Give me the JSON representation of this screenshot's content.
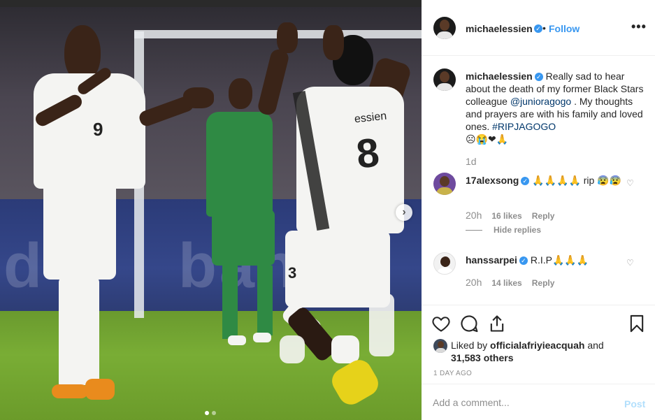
{
  "post": {
    "author": "michaelessien",
    "follow_label": "Follow",
    "separator": "•",
    "more_icon": "more-horizontal-icon",
    "carousel_next_icon": "chevron-right-icon"
  },
  "caption": {
    "username": "michaelessien",
    "text_before": "Really sad to hear about the death of my former Black Stars colleague ",
    "mention": "@junioragogo",
    "text_after": " . My thoughts and prayers are with his family and loved ones. ",
    "hashtag": "#RIPJAGOGO",
    "emojis": "☹😭❤🙏",
    "time": "1d"
  },
  "comments": [
    {
      "username": "17alexsong",
      "text": "🙏🙏🙏🙏 rip 😰😰",
      "time": "20h",
      "likes": "16 likes",
      "reply_label": "Reply"
    },
    {
      "username": "hanssarpei",
      "text": "R.I.P🙏🙏🙏",
      "time": "20h",
      "likes": "14 likes",
      "reply_label": "Reply"
    }
  ],
  "hide_replies_label": "Hide replies",
  "likes_summary": {
    "prefix": "Liked by ",
    "user": "officialafriyieacquah",
    "middle": " and",
    "count_text": "31,583 others"
  },
  "posted_ago": "1 DAY AGO",
  "add_comment": {
    "placeholder": "Add a comment...",
    "post_label": "Post"
  },
  "photo": {
    "jersey_left": "9",
    "jersey_right_name": "essien",
    "jersey_right": "8",
    "jersey_back_num": "3",
    "board_text_left": "d",
    "board_text_right": "ban",
    "carousel_dots": 2,
    "carousel_active": 1
  },
  "colors": {
    "accent": "#3897f0",
    "link": "#00376b",
    "muted": "#8e8e8e",
    "post_disabled": "#b2dffc"
  }
}
